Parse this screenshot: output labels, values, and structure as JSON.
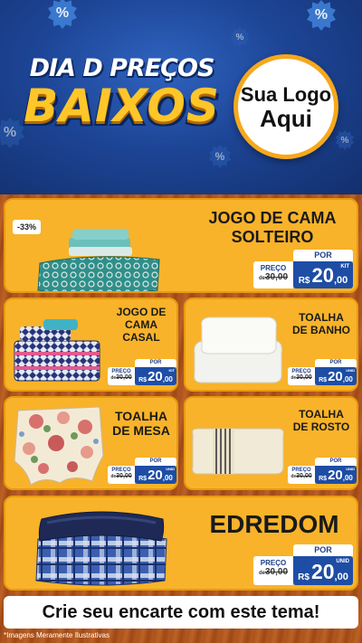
{
  "header": {
    "title_line1": "DIA D PREÇOS",
    "title_line2": "BAIXOS",
    "logo_line1": "Sua Logo",
    "logo_line2": "Aqui",
    "badge_symbol": "%"
  },
  "products": [
    {
      "name_line1": "JOGO DE CAMA",
      "name_line2": "SOLTEIRO",
      "name_line3": "",
      "discount": "-33%",
      "price_label": "PREÇO",
      "old_prefix": "de",
      "old_price": "30,00",
      "por_label": "POR",
      "currency": "R$",
      "price_int": "20",
      "price_dec": ",00",
      "unit": "KIT"
    },
    {
      "name_line1": "JOGO DE",
      "name_line2": "CAMA",
      "name_line3": "CASAL",
      "price_label": "PREÇO",
      "old_prefix": "de",
      "old_price": "30,00",
      "por_label": "POR",
      "currency": "R$",
      "price_int": "20",
      "price_dec": ",00",
      "unit": "KIT"
    },
    {
      "name_line1": "TOALHA",
      "name_line2": "DE BANHO",
      "price_label": "PREÇO",
      "old_prefix": "de",
      "old_price": "30,00",
      "por_label": "POR",
      "currency": "R$",
      "price_int": "20",
      "price_dec": ",00",
      "unit": "UNID"
    },
    {
      "name_line1": "TOALHA",
      "name_line2": "DE MESA",
      "price_label": "PREÇO",
      "old_prefix": "de",
      "old_price": "30,00",
      "por_label": "POR",
      "currency": "R$",
      "price_int": "20",
      "price_dec": ",00",
      "unit": "UNID"
    },
    {
      "name_line1": "TOALHA",
      "name_line2": "DE ROSTO",
      "price_label": "PREÇO",
      "old_prefix": "de",
      "old_price": "30,00",
      "por_label": "POR",
      "currency": "R$",
      "price_int": "20",
      "price_dec": ",00",
      "unit": "UNID"
    },
    {
      "name_line1": "EDREDOM",
      "price_label": "PREÇO",
      "old_prefix": "de",
      "old_price": "30,00",
      "por_label": "POR",
      "currency": "R$",
      "price_int": "20",
      "price_dec": ",00",
      "unit": "UNID"
    }
  ],
  "footer": {
    "cta": "Crie seu encarte com este tema!",
    "disclaimer": "*Imagens Meramente Ilustrativas"
  },
  "colors": {
    "header_blue": "#1d4596",
    "title_gold": "#ffc629",
    "card_orange": "#f8b32a",
    "price_blue": "#1d4da5",
    "wood": "#b35a20"
  }
}
